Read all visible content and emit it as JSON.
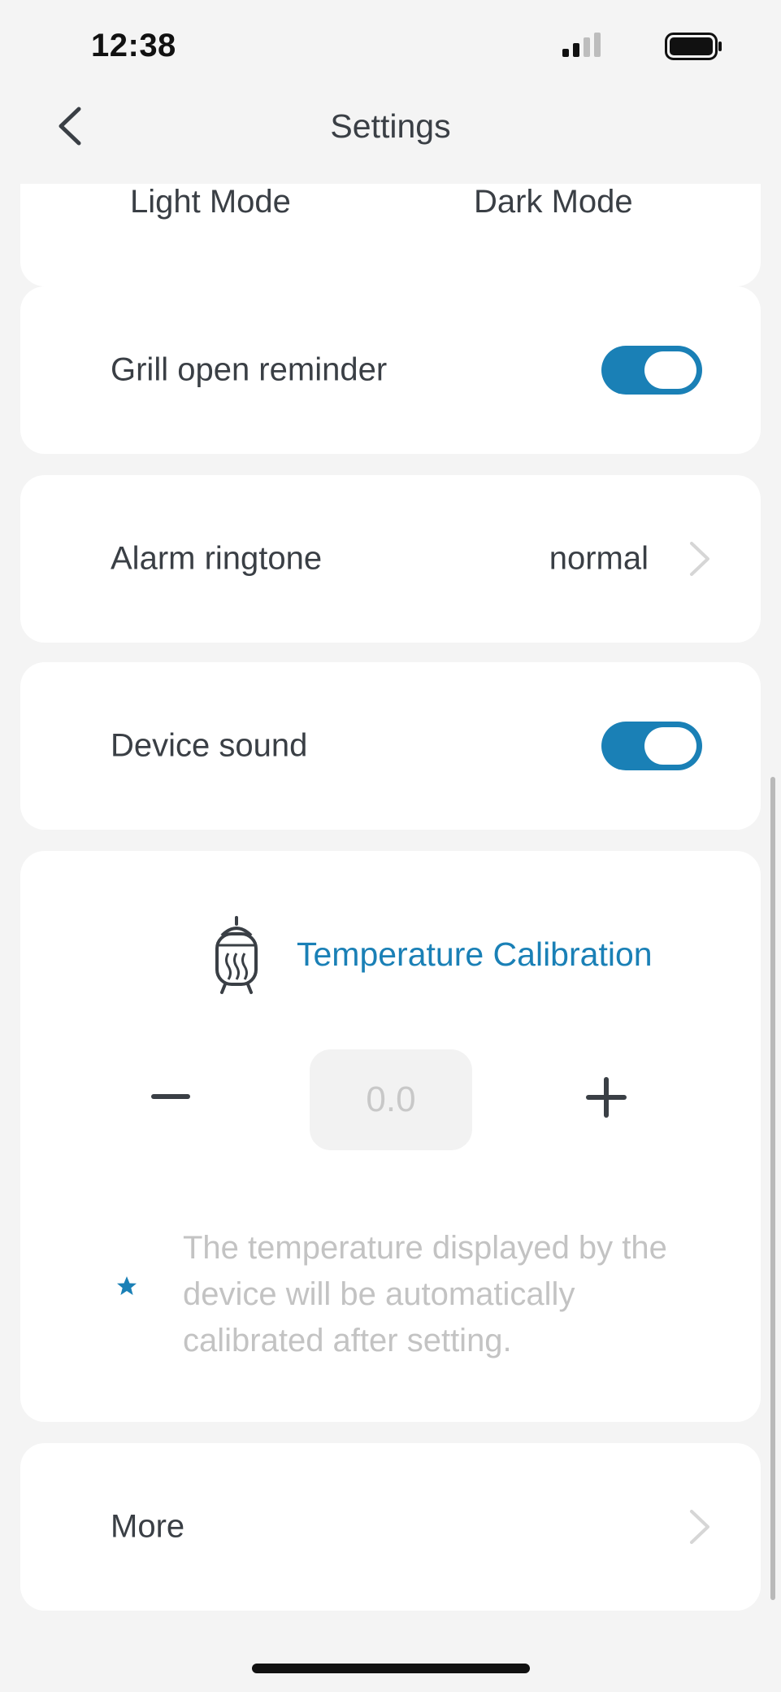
{
  "status_bar": {
    "time": "12:38"
  },
  "nav": {
    "title": "Settings"
  },
  "theme": {
    "light_label": "Light Mode",
    "dark_label": "Dark Mode"
  },
  "settings": {
    "grill_open_reminder": {
      "label": "Grill open reminder",
      "enabled": true
    },
    "alarm_ringtone": {
      "label": "Alarm ringtone",
      "value": "normal"
    },
    "device_sound": {
      "label": "Device sound",
      "enabled": true
    },
    "more": {
      "label": "More"
    }
  },
  "calibration": {
    "title": "Temperature Calibration",
    "value": "0.0",
    "note": "The temperature displayed by the device will be automatically calibrated after setting."
  },
  "colors": {
    "accent": "#1a80b6",
    "background": "#f4f4f4",
    "card": "#ffffff",
    "text": "#3a3f45",
    "muted": "#c3c3c3"
  },
  "icons": {
    "back": "chevron-left-icon",
    "chevron": "chevron-right-icon",
    "grill": "grill-icon",
    "minus": "minus-icon",
    "plus": "plus-icon",
    "star": "star-icon",
    "signal": "cellular-signal-icon",
    "battery": "battery-icon"
  }
}
